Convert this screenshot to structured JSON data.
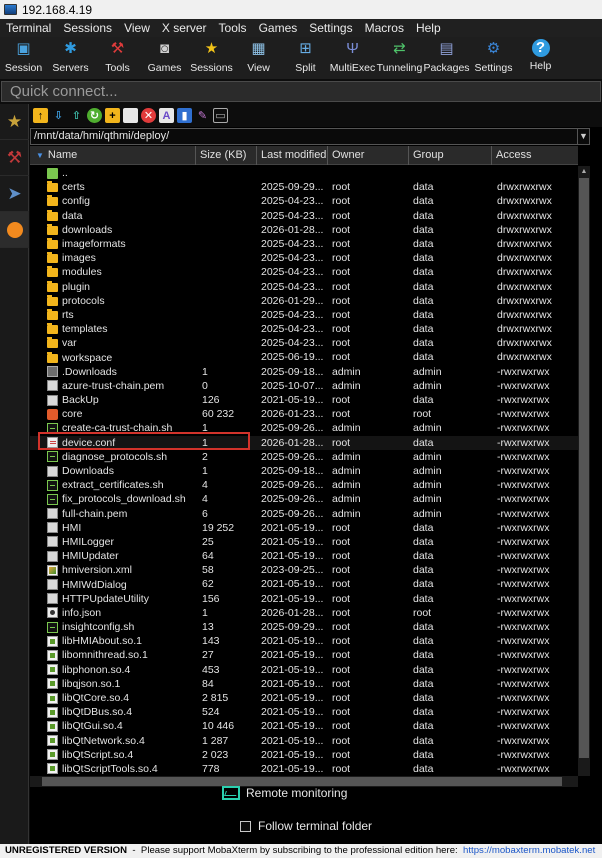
{
  "window": {
    "title": "192.168.4.19"
  },
  "menu": [
    "Terminal",
    "Sessions",
    "View",
    "X server",
    "Tools",
    "Games",
    "Settings",
    "Macros",
    "Help"
  ],
  "toolbar": [
    {
      "label": "Session",
      "icon": "session-icon",
      "color": "#4aa3df",
      "glyph": "▣"
    },
    {
      "label": "Servers",
      "icon": "servers-icon",
      "color": "#2f9be0",
      "glyph": "✱"
    },
    {
      "label": "Tools",
      "icon": "tools-icon",
      "color": "#e03b3b",
      "glyph": "⚒"
    },
    {
      "label": "Games",
      "icon": "games-icon",
      "color": "#d0d0d0",
      "glyph": "◙"
    },
    {
      "label": "Sessions",
      "icon": "star-icon",
      "color": "#f2c318",
      "glyph": "★"
    },
    {
      "label": "View",
      "icon": "view-icon",
      "color": "#8fc3e8",
      "glyph": "▦"
    },
    {
      "label": "Split",
      "icon": "split-icon",
      "color": "#67aee6",
      "glyph": "⊞"
    },
    {
      "label": "MultiExec",
      "icon": "multiexec-icon",
      "color": "#7b8ed8",
      "glyph": "Ψ"
    },
    {
      "label": "Tunneling",
      "icon": "tunneling-icon",
      "color": "#4fc36a",
      "glyph": "⇄"
    },
    {
      "label": "Packages",
      "icon": "packages-icon",
      "color": "#8fa0d8",
      "glyph": "▤"
    },
    {
      "label": "Settings",
      "icon": "gear-icon",
      "color": "#3b86d8",
      "glyph": "⚙"
    },
    {
      "label": "Help",
      "icon": "help-icon",
      "color": "#2f9be0",
      "glyph": "?"
    }
  ],
  "quick_connect": {
    "placeholder": "Quick connect..."
  },
  "sftp": {
    "path": "/mnt/data/hmi/qthmi/deploy/",
    "columns": [
      "Name",
      "Size (KB)",
      "Last modified",
      "Owner",
      "Group",
      "Access"
    ],
    "rows": [
      {
        "name": "..",
        "size": "",
        "modified": "",
        "owner": "",
        "group": "",
        "access": "",
        "type": "up"
      },
      {
        "name": "certs",
        "size": "",
        "modified": "2025-09-29...",
        "owner": "root",
        "group": "data",
        "access": "drwxrwxrwx",
        "type": "folder"
      },
      {
        "name": "config",
        "size": "",
        "modified": "2025-04-23...",
        "owner": "root",
        "group": "data",
        "access": "drwxrwxrwx",
        "type": "folder"
      },
      {
        "name": "data",
        "size": "",
        "modified": "2025-04-23...",
        "owner": "root",
        "group": "data",
        "access": "drwxrwxrwx",
        "type": "folder"
      },
      {
        "name": "downloads",
        "size": "",
        "modified": "2026-01-28...",
        "owner": "root",
        "group": "data",
        "access": "drwxrwxrwx",
        "type": "folder"
      },
      {
        "name": "imageformats",
        "size": "",
        "modified": "2025-04-23...",
        "owner": "root",
        "group": "data",
        "access": "drwxrwxrwx",
        "type": "folder"
      },
      {
        "name": "images",
        "size": "",
        "modified": "2025-04-23...",
        "owner": "root",
        "group": "data",
        "access": "drwxrwxrwx",
        "type": "folder"
      },
      {
        "name": "modules",
        "size": "",
        "modified": "2025-04-23...",
        "owner": "root",
        "group": "data",
        "access": "drwxrwxrwx",
        "type": "folder"
      },
      {
        "name": "plugin",
        "size": "",
        "modified": "2025-04-23...",
        "owner": "root",
        "group": "data",
        "access": "drwxrwxrwx",
        "type": "folder"
      },
      {
        "name": "protocols",
        "size": "",
        "modified": "2026-01-29...",
        "owner": "root",
        "group": "data",
        "access": "drwxrwxrwx",
        "type": "folder"
      },
      {
        "name": "rts",
        "size": "",
        "modified": "2025-04-23...",
        "owner": "root",
        "group": "data",
        "access": "drwxrwxrwx",
        "type": "folder"
      },
      {
        "name": "templates",
        "size": "",
        "modified": "2025-04-23...",
        "owner": "root",
        "group": "data",
        "access": "drwxrwxrwx",
        "type": "folder"
      },
      {
        "name": "var",
        "size": "",
        "modified": "2025-04-23...",
        "owner": "root",
        "group": "data",
        "access": "drwxrwxrwx",
        "type": "folder"
      },
      {
        "name": "workspace",
        "size": "",
        "modified": "2025-06-19...",
        "owner": "root",
        "group": "data",
        "access": "drwxrwxrwx",
        "type": "folder"
      },
      {
        "name": ".Downloads",
        "size": "1",
        "modified": "2025-09-18...",
        "owner": "admin",
        "group": "admin",
        "access": "-rwxrwxrwx",
        "type": "exe"
      },
      {
        "name": "azure-trust-chain.pem",
        "size": "0",
        "modified": "2025-10-07...",
        "owner": "admin",
        "group": "admin",
        "access": "-rwxrwxrwx",
        "type": "file"
      },
      {
        "name": "BackUp",
        "size": "126",
        "modified": "2021-05-19...",
        "owner": "root",
        "group": "data",
        "access": "-rwxrwxrwx",
        "type": "file"
      },
      {
        "name": "core",
        "size": "60 232",
        "modified": "2026-01-23...",
        "owner": "root",
        "group": "root",
        "access": "-rwxrwxrwx",
        "type": "core"
      },
      {
        "name": "create-ca-trust-chain.sh",
        "size": "1",
        "modified": "2025-09-26...",
        "owner": "admin",
        "group": "admin",
        "access": "-rwxrwxrwx",
        "type": "script"
      },
      {
        "name": "device.conf",
        "size": "1",
        "modified": "2026-01-28...",
        "owner": "root",
        "group": "data",
        "access": "-rwxrwxrwx",
        "type": "conf"
      },
      {
        "name": "diagnose_protocols.sh",
        "size": "2",
        "modified": "2025-09-26...",
        "owner": "admin",
        "group": "admin",
        "access": "-rwxrwxrwx",
        "type": "script"
      },
      {
        "name": "Downloads",
        "size": "1",
        "modified": "2025-09-18...",
        "owner": "admin",
        "group": "admin",
        "access": "-rwxrwxrwx",
        "type": "file"
      },
      {
        "name": "extract_certificates.sh",
        "size": "4",
        "modified": "2025-09-26...",
        "owner": "admin",
        "group": "admin",
        "access": "-rwxrwxrwx",
        "type": "script"
      },
      {
        "name": "fix_protocols_download.sh",
        "size": "4",
        "modified": "2025-09-26...",
        "owner": "admin",
        "group": "admin",
        "access": "-rwxrwxrwx",
        "type": "script"
      },
      {
        "name": "full-chain.pem",
        "size": "6",
        "modified": "2025-09-26...",
        "owner": "admin",
        "group": "admin",
        "access": "-rwxrwxrwx",
        "type": "file"
      },
      {
        "name": "HMI",
        "size": "19 252",
        "modified": "2021-05-19...",
        "owner": "root",
        "group": "data",
        "access": "-rwxrwxrwx",
        "type": "file"
      },
      {
        "name": "HMILogger",
        "size": "25",
        "modified": "2021-05-19...",
        "owner": "root",
        "group": "data",
        "access": "-rwxrwxrwx",
        "type": "file"
      },
      {
        "name": "HMIUpdater",
        "size": "64",
        "modified": "2021-05-19...",
        "owner": "root",
        "group": "data",
        "access": "-rwxrwxrwx",
        "type": "file"
      },
      {
        "name": "hmiversion.xml",
        "size": "58",
        "modified": "2023-09-25...",
        "owner": "root",
        "group": "data",
        "access": "-rwxrwxrwx",
        "type": "xml"
      },
      {
        "name": "HMIWdDialog",
        "size": "62",
        "modified": "2021-05-19...",
        "owner": "root",
        "group": "data",
        "access": "-rwxrwxrwx",
        "type": "file"
      },
      {
        "name": "HTTPUpdateUtility",
        "size": "156",
        "modified": "2021-05-19...",
        "owner": "root",
        "group": "data",
        "access": "-rwxrwxrwx",
        "type": "file"
      },
      {
        "name": "info.json",
        "size": "1",
        "modified": "2026-01-28...",
        "owner": "root",
        "group": "root",
        "access": "-rwxrwxrwx",
        "type": "json"
      },
      {
        "name": "insightconfig.sh",
        "size": "13",
        "modified": "2025-09-29...",
        "owner": "root",
        "group": "data",
        "access": "-rwxrwxrwx",
        "type": "script"
      },
      {
        "name": "libHMIAbout.so.1",
        "size": "143",
        "modified": "2021-05-19...",
        "owner": "root",
        "group": "data",
        "access": "-rwxrwxrwx",
        "type": "so"
      },
      {
        "name": "libomnithread.so.1",
        "size": "27",
        "modified": "2021-05-19...",
        "owner": "root",
        "group": "data",
        "access": "-rwxrwxrwx",
        "type": "so"
      },
      {
        "name": "libphonon.so.4",
        "size": "453",
        "modified": "2021-05-19...",
        "owner": "root",
        "group": "data",
        "access": "-rwxrwxrwx",
        "type": "so"
      },
      {
        "name": "libqjson.so.1",
        "size": "84",
        "modified": "2021-05-19...",
        "owner": "root",
        "group": "data",
        "access": "-rwxrwxrwx",
        "type": "so"
      },
      {
        "name": "libQtCore.so.4",
        "size": "2 815",
        "modified": "2021-05-19...",
        "owner": "root",
        "group": "data",
        "access": "-rwxrwxrwx",
        "type": "so"
      },
      {
        "name": "libQtDBus.so.4",
        "size": "524",
        "modified": "2021-05-19...",
        "owner": "root",
        "group": "data",
        "access": "-rwxrwxrwx",
        "type": "so"
      },
      {
        "name": "libQtGui.so.4",
        "size": "10 446",
        "modified": "2021-05-19...",
        "owner": "root",
        "group": "data",
        "access": "-rwxrwxrwx",
        "type": "so"
      },
      {
        "name": "libQtNetwork.so.4",
        "size": "1 287",
        "modified": "2021-05-19...",
        "owner": "root",
        "group": "data",
        "access": "-rwxrwxrwx",
        "type": "so"
      },
      {
        "name": "libQtScript.so.4",
        "size": "2 023",
        "modified": "2021-05-19...",
        "owner": "root",
        "group": "data",
        "access": "-rwxrwxrwx",
        "type": "so"
      },
      {
        "name": "libQtScriptTools.so.4",
        "size": "778",
        "modified": "2021-05-19...",
        "owner": "root",
        "group": "data",
        "access": "-rwxrwxrwx",
        "type": "so"
      }
    ]
  },
  "remote_monitoring": "Remote monitoring",
  "follow_terminal": "Follow terminal folder",
  "status": {
    "unregistered": "UNREGISTERED VERSION",
    "message": "  -  Please support MobaXterm by subscribing to the professional edition here:  ",
    "link": "https://mobaxterm.mobatek.net"
  }
}
